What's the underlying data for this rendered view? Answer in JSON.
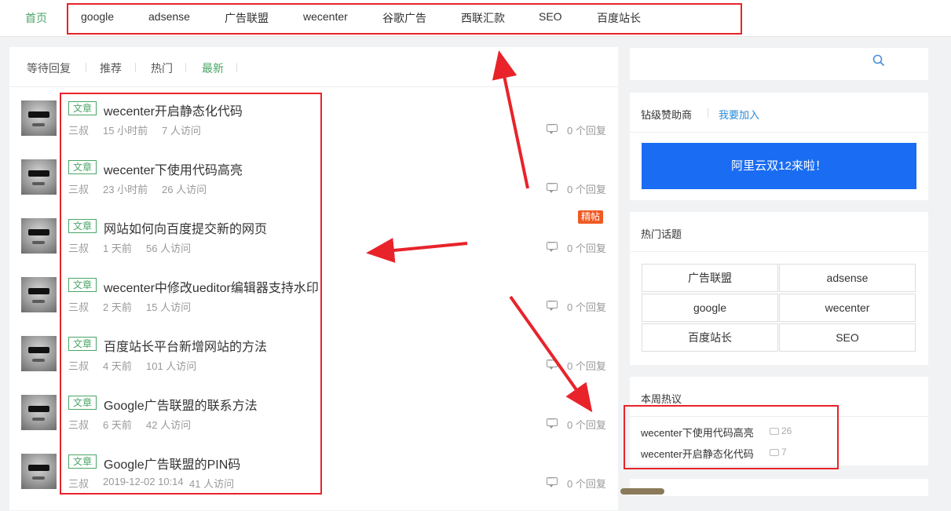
{
  "nav": {
    "items": [
      {
        "label": "首页",
        "active": true
      },
      {
        "label": "google"
      },
      {
        "label": "adsense"
      },
      {
        "label": "广告联盟"
      },
      {
        "label": "wecenter"
      },
      {
        "label": "谷歌广告"
      },
      {
        "label": "西联汇款"
      },
      {
        "label": "SEO"
      },
      {
        "label": "百度站长"
      }
    ]
  },
  "tabs": [
    {
      "label": "等待回复"
    },
    {
      "label": "推荐"
    },
    {
      "label": "热门"
    },
    {
      "label": "最新",
      "active": true
    }
  ],
  "posts": [
    {
      "tag": "文章",
      "title": "wecenter开启静态化代码",
      "author": "三叔",
      "time": "15 小时前",
      "visits": "7 人访问",
      "reply_count": "0",
      "reply_label": "个回复"
    },
    {
      "tag": "文章",
      "title": "wecenter下使用代码高亮",
      "author": "三叔",
      "time": "23 小时前",
      "visits": "26 人访问",
      "reply_count": "0",
      "reply_label": "个回复"
    },
    {
      "tag": "文章",
      "title": "网站如何向百度提交新的网页",
      "author": "三叔",
      "time": "1 天前",
      "visits": "56 人访问",
      "reply_count": "0",
      "reply_label": "个回复",
      "badge": "精帖"
    },
    {
      "tag": "文章",
      "title": "wecenter中修改ueditor编辑器支持水印",
      "author": "三叔",
      "time": "2 天前",
      "visits": "15 人访问",
      "reply_count": "0",
      "reply_label": "个回复"
    },
    {
      "tag": "文章",
      "title": "百度站长平台新增网站的方法",
      "author": "三叔",
      "time": "4 天前",
      "visits": "101 人访问",
      "reply_count": "0",
      "reply_label": "个回复"
    },
    {
      "tag": "文章",
      "title": "Google广告联盟的联系方法",
      "author": "三叔",
      "time": "6 天前",
      "visits": "42 人访问",
      "reply_count": "0",
      "reply_label": "个回复"
    },
    {
      "tag": "文章",
      "title": "Google广告联盟的PIN码",
      "author": "三叔",
      "time": "2019-12-02 10:14",
      "visits": "41 人访问",
      "reply_count": "0",
      "reply_label": "个回复"
    }
  ],
  "sidebar": {
    "search_icon": "search-icon",
    "sponsor": {
      "title": "钻级赞助商",
      "join_label": "我要加入",
      "banner_text": "阿里云双12来啦！"
    },
    "hot_topics": {
      "title": "热门话题",
      "topics": [
        "广告联盟",
        "adsense",
        "google",
        "wecenter",
        "百度站长",
        "SEO"
      ]
    },
    "weekly": {
      "title": "本周热议",
      "items": [
        {
          "title": "wecenter下使用代码高亮",
          "count": "26"
        },
        {
          "title": "wecenter开启静态化代码",
          "count": "7"
        }
      ]
    }
  },
  "colors": {
    "accent": "#4aa567",
    "banner": "#1a6cf2",
    "hot_badge": "#f05a23",
    "annotation_red": "#e8232a"
  }
}
